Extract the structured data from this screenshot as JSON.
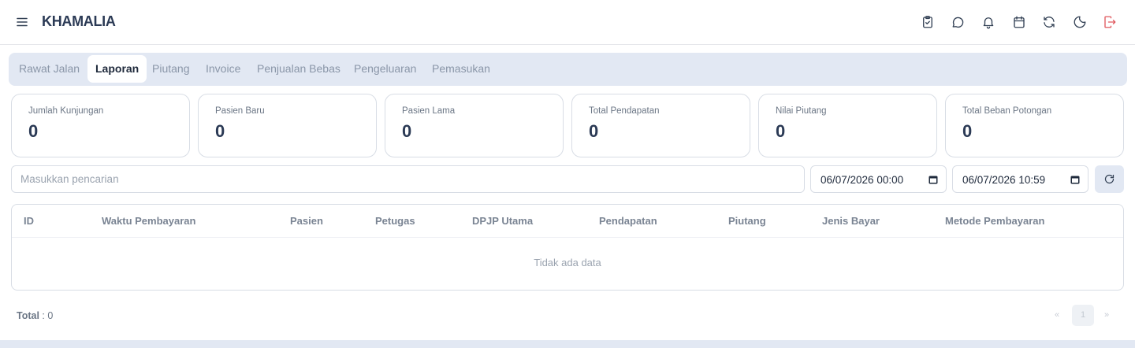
{
  "app": {
    "title": "KHAMALIA"
  },
  "header": {
    "icons": [
      "clipboard-check-icon",
      "message-icon",
      "bell-icon",
      "calendar-icon",
      "refresh-icon",
      "moon-icon",
      "logout-icon"
    ],
    "logout_color": "#e0595f"
  },
  "tabs": [
    {
      "label": "Rawat Jalan",
      "active": false
    },
    {
      "label": "Laporan",
      "active": true
    },
    {
      "label": "Piutang",
      "active": false
    },
    {
      "label": "Invoice",
      "active": false
    },
    {
      "label": "Penjualan Bebas",
      "active": false
    },
    {
      "label": "Pengeluaran",
      "active": false
    },
    {
      "label": "Pemasukan",
      "active": false
    }
  ],
  "stats": [
    {
      "label": "Jumlah Kunjungan",
      "value": "0"
    },
    {
      "label": "Pasien Baru",
      "value": "0"
    },
    {
      "label": "Pasien Lama",
      "value": "0"
    },
    {
      "label": "Total Pendapatan",
      "value": "0"
    },
    {
      "label": "Nilai Piutang",
      "value": "0"
    },
    {
      "label": "Total Beban Potongan",
      "value": "0"
    }
  ],
  "filters": {
    "search_placeholder": "Masukkan pencarian",
    "date_from": "06/07/2026 00:00",
    "date_to": "06/07/2026 10:59"
  },
  "table": {
    "columns": [
      "ID",
      "Waktu Pembayaran",
      "Pasien",
      "Petugas",
      "DPJP Utama",
      "Pendapatan",
      "Piutang",
      "Jenis Bayar",
      "Metode Pembayaran"
    ],
    "empty_text": "Tidak ada data"
  },
  "footer": {
    "total_label": "Total",
    "total_value": ": 0",
    "prev": "«",
    "page": "1",
    "next": "»"
  },
  "colors": {
    "accent_bg": "#e2e8f3",
    "brand_text": "#2b3a55"
  }
}
